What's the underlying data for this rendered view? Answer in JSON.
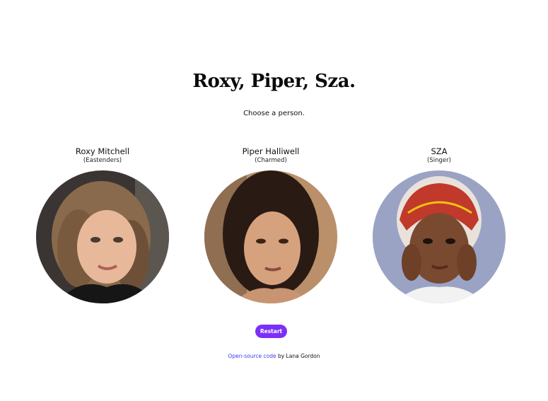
{
  "header": {
    "title": "Roxy, Piper, Sza.",
    "subtitle": "Choose a person."
  },
  "people": [
    {
      "name": "Roxy Mitchell",
      "role": "(Eastenders)",
      "photo": "portrait-roxy-mitchell"
    },
    {
      "name": "Piper Halliwell",
      "role": "(Charmed)",
      "photo": "portrait-piper-halliwell"
    },
    {
      "name": "SZA",
      "role": "(Singer)",
      "photo": "portrait-sza"
    }
  ],
  "actions": {
    "restart_label": "Restart"
  },
  "footer": {
    "link_text": "Open-source code",
    "suffix": " by Lana Gordon"
  },
  "colors": {
    "accent": "#7b2ff7",
    "link": "#3b3bf5",
    "background": "#ffffff"
  }
}
